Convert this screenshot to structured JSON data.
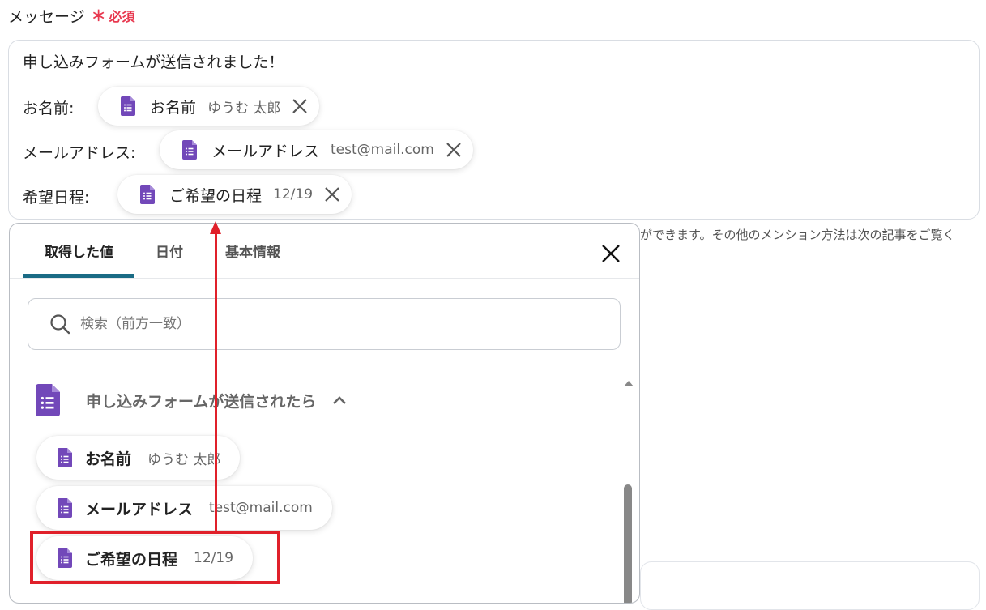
{
  "field": {
    "label": "メッセージ",
    "required_star": "＊",
    "required_text": "必須"
  },
  "message": {
    "line1": "申し込みフォームが送信されました！",
    "rows": [
      {
        "label": "お名前:",
        "chip_name": "お名前",
        "chip_value": "ゆうむ 太郎"
      },
      {
        "label": "メールアドレス:",
        "chip_name": "メールアドレス",
        "chip_value": "test@mail.com"
      },
      {
        "label": "希望日程:",
        "chip_name": "ご希望の日程",
        "chip_value": "12/19"
      }
    ]
  },
  "helper_text": "ができます。その他のメンション方法は次の記事をご覧く",
  "panel": {
    "tabs": [
      {
        "label": "取得した値",
        "active": true
      },
      {
        "label": "日付",
        "active": false
      },
      {
        "label": "基本情報",
        "active": false
      }
    ],
    "search_placeholder": "検索（前方一致）",
    "group_title": "申し込みフォームが送信されたら",
    "items": [
      {
        "name": "お名前",
        "value": "ゆうむ 太郎"
      },
      {
        "name": "メールアドレス",
        "value": "test@mail.com"
      },
      {
        "name": "ご希望の日程",
        "value": "12/19"
      }
    ]
  },
  "colors": {
    "required": "#e8384f",
    "forms_icon": "#7248b9",
    "tab_underline": "#1a6b85",
    "annotation": "#e0202a"
  },
  "icons": {
    "chip_icon": "google-forms-icon",
    "remove": "close-icon",
    "search": "search-icon",
    "collapse": "chevron-up-icon",
    "scroll": "scroll-up-arrow-icon"
  }
}
